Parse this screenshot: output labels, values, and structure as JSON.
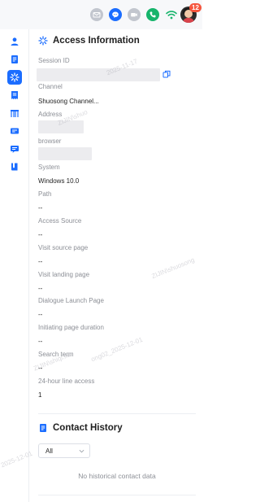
{
  "topbar": {
    "icons": [
      "mail-icon",
      "chat-icon",
      "video-icon",
      "phone-icon",
      "wifi-icon"
    ],
    "colors": {
      "mail": "#b8bcc4",
      "chat": "#1b6dff",
      "video": "#b8bcc4",
      "phone": "#16b46b",
      "wifi": "#16b46b"
    },
    "badge_count": "12"
  },
  "rail": {
    "items": [
      "user-icon",
      "note-icon",
      "access-info-icon",
      "receipt-icon",
      "store-icon",
      "ticket-icon",
      "message-card-icon",
      "book-icon"
    ],
    "active_index": 2,
    "accent": "#1b6dff"
  },
  "access_info": {
    "title": "Access Information",
    "fields": [
      {
        "label": "Session ID",
        "value": ""
      },
      {
        "label": "Channel",
        "value": "Shuosong Channel..."
      },
      {
        "label": "Address",
        "value": ""
      },
      {
        "label": "browser",
        "value": ""
      },
      {
        "label": "System",
        "value": "Windows 10.0"
      },
      {
        "label": "Path",
        "value": "--"
      },
      {
        "label": "Access Source",
        "value": "--"
      },
      {
        "label": "Visit source page",
        "value": "--"
      },
      {
        "label": "Visit landing page",
        "value": "--"
      },
      {
        "label": "Dialogue Launch Page",
        "value": "--"
      },
      {
        "label": "Initiating page duration",
        "value": "--"
      },
      {
        "label": "Search term",
        "value": "--"
      },
      {
        "label": "24-hour line access",
        "value": "1"
      }
    ]
  },
  "contact_history": {
    "title": "Contact History",
    "filter": "All",
    "empty_text": "No historical contact data"
  },
  "watermarks": [
    "2025-11-17",
    "ZIJIN\\shuo",
    "ZIJIN\\shuosong",
    "ZIJIN\\shiqi.liu",
    "ong02_2025-12-01",
    "2025-12-01"
  ]
}
